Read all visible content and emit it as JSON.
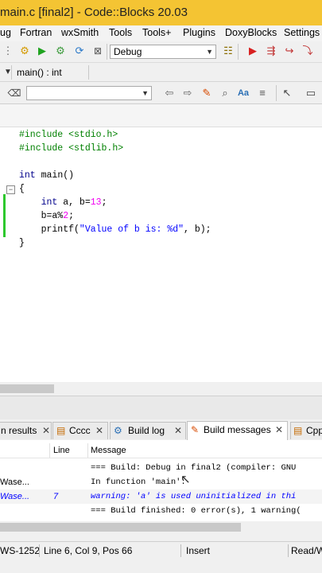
{
  "window": {
    "title": "main.c [final2] - Code::Blocks 20.03"
  },
  "menu": [
    "ug",
    "Fortran",
    "wxSmith",
    "Tools",
    "Tools+",
    "Plugins",
    "DoxyBlocks",
    "Settings"
  ],
  "toolbar": {
    "build_target": "Debug",
    "icons": [
      "gear-icon",
      "play-icon",
      "gear-run-icon",
      "rebuild-icon",
      "abort-icon"
    ]
  },
  "scope": {
    "function": "main() : int"
  },
  "search": {
    "value": ""
  },
  "editor": {
    "lines": [
      {
        "parts": [
          {
            "t": "#include <stdio.h>",
            "c": "pp"
          }
        ]
      },
      {
        "parts": [
          {
            "t": "#include <stdlib.h>",
            "c": "pp"
          }
        ]
      },
      {
        "parts": []
      },
      {
        "parts": [
          {
            "t": "int",
            "c": "kw"
          },
          {
            "t": " main()",
            "c": ""
          }
        ]
      },
      {
        "parts": [
          {
            "t": "{",
            "c": ""
          }
        ]
      },
      {
        "parts": [
          {
            "t": "    ",
            "c": ""
          },
          {
            "t": "int",
            "c": "kw"
          },
          {
            "t": " a, b=",
            "c": ""
          },
          {
            "t": "13",
            "c": "num"
          },
          {
            "t": ";",
            "c": ""
          }
        ]
      },
      {
        "parts": [
          {
            "t": "    b=a%",
            "c": ""
          },
          {
            "t": "2",
            "c": "num"
          },
          {
            "t": ";",
            "c": ""
          }
        ]
      },
      {
        "parts": [
          {
            "t": "    printf(",
            "c": ""
          },
          {
            "t": "\"Value of b is: %d\"",
            "c": "str"
          },
          {
            "t": ", b);",
            "c": ""
          }
        ]
      },
      {
        "parts": [
          {
            "t": "}",
            "c": ""
          }
        ]
      }
    ]
  },
  "logs": {
    "tabs": [
      {
        "label": "n results",
        "icon": ""
      },
      {
        "label": "Cccc",
        "icon": "document-icon"
      },
      {
        "label": "Build log",
        "icon": "gear-icon"
      },
      {
        "label": "Build messages",
        "icon": "pencil-icon"
      },
      {
        "label": "Cpp",
        "icon": "document-icon"
      }
    ],
    "headers": {
      "file": "",
      "line": "Line",
      "message": "Message"
    },
    "rows": [
      {
        "file": "",
        "line": "",
        "message": "=== Build: Debug in final2 (compiler: GNU",
        "warn": false
      },
      {
        "file": "Wase...",
        "line": "",
        "message": "In function 'main':",
        "warn": false
      },
      {
        "file": "Wase...",
        "line": "7",
        "message": "warning: 'a' is used uninitialized in thi",
        "warn": true
      },
      {
        "file": "",
        "line": "",
        "message": "=== Build finished: 0 error(s), 1 warning(",
        "warn": false
      }
    ]
  },
  "status": {
    "encoding": "WS-1252",
    "position": "Line 6, Col 9, Pos 66",
    "mode": "Insert",
    "access": "Read/W"
  }
}
